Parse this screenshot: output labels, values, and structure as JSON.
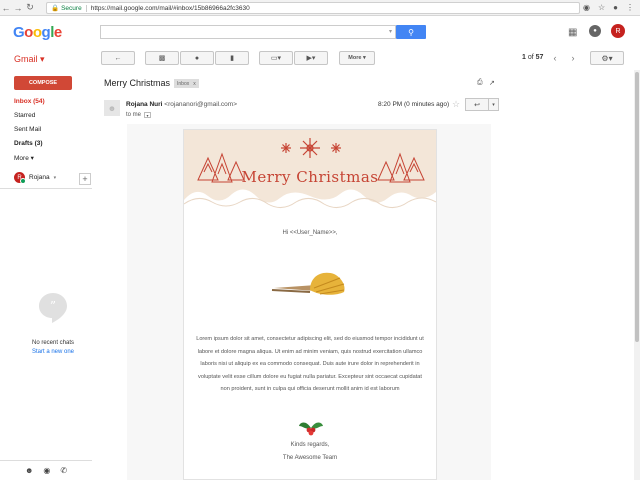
{
  "browser": {
    "secure_label": "Secure",
    "url": "https://mail.google.com/mail/#inbox/15b86966a2fc3630"
  },
  "header": {
    "logo_parts": [
      "G",
      "o",
      "o",
      "g",
      "l",
      "e"
    ],
    "avatar_initial": "R"
  },
  "app": {
    "name": "Gmail"
  },
  "toolbar": {
    "more_label": "More",
    "pager_range": "1",
    "pager_of": "of",
    "pager_total": "57"
  },
  "sidebar": {
    "compose_label": "COMPOSE",
    "items": [
      {
        "label": "Inbox (54)"
      },
      {
        "label": "Starred"
      },
      {
        "label": "Sent Mail"
      },
      {
        "label": "Drafts (3)"
      },
      {
        "label": "More"
      }
    ],
    "hangouts_user": "Rojana",
    "hangouts_initial": "R",
    "no_chats": "No recent chats",
    "start_chat": "Start a new one"
  },
  "message": {
    "subject": "Merry Christmas",
    "label_tag": "Inbox",
    "label_close": "x",
    "sender_name": "Rojana Nuri",
    "sender_email": "<rojananori@gmail.com>",
    "to": "to me",
    "time": "8:20 PM (0 minutes ago)"
  },
  "email_body": {
    "banner_text": "Merry Christmas",
    "greeting": "Hi <<User_Name>>,",
    "paragraph": "Lorem ipsum dolor sit amet, consectetur adipiscing elit, sed do eiusmod tempor incididunt ut labore et dolore magna aliqua. Ut enim ad minim veniam, quis nostrud exercitation ullamco laboris nisi ut aliquip ex ea commodo consequat. Duis aute irure dolor in reprehenderit in voluptate velit esse cillum dolore eu fugiat nulla pariatur. Excepteur sint occaecat cupidatat non proident, sunt in culpa qui officia deserunt mollit anim id est laborum",
    "regards": "Kinds regards,",
    "team": "The Awesome Team"
  },
  "colors": {
    "accent_red": "#d14836",
    "link_blue": "#1a73e8",
    "banner_bg": "#f3e6d8",
    "banner_red": "#c64434"
  }
}
